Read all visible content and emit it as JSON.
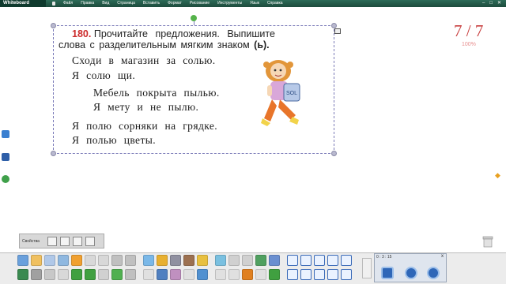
{
  "app": {
    "title": "Whiteboard"
  },
  "menu": {
    "items": [
      "Файл",
      "Правка",
      "Вид",
      "Страница",
      "Вставить",
      "Формат",
      "Рисование",
      "Инструменты",
      "Язык",
      "Справка"
    ]
  },
  "exercise": {
    "number": "180.",
    "instruction_line1": "Прочитайте предложения. Выпишите",
    "instruction_line2_prefix": "слова с разделительным мягким знаком ",
    "instruction_line2_letter": "(ь).",
    "sentences": [
      "Сходи в магазин за солью.",
      "Я солю щи.",
      "Мебель покрыта пылью.",
      "Я мету и не пылю.",
      "Я полю сорняки на грядке.",
      "Я полью цветы."
    ],
    "jar_label": "SOL"
  },
  "page": {
    "counter": "7 / 7",
    "zoom": "100%"
  },
  "properties_panel": {
    "label": "Свойства"
  },
  "palette": {
    "time": "0 : 3 : 15",
    "close": "x"
  },
  "colors": {
    "menubar": "#1f4f40",
    "accent_red": "#c84040",
    "selection": "#7a7ab8",
    "rotate_handle": "#55b34a"
  }
}
